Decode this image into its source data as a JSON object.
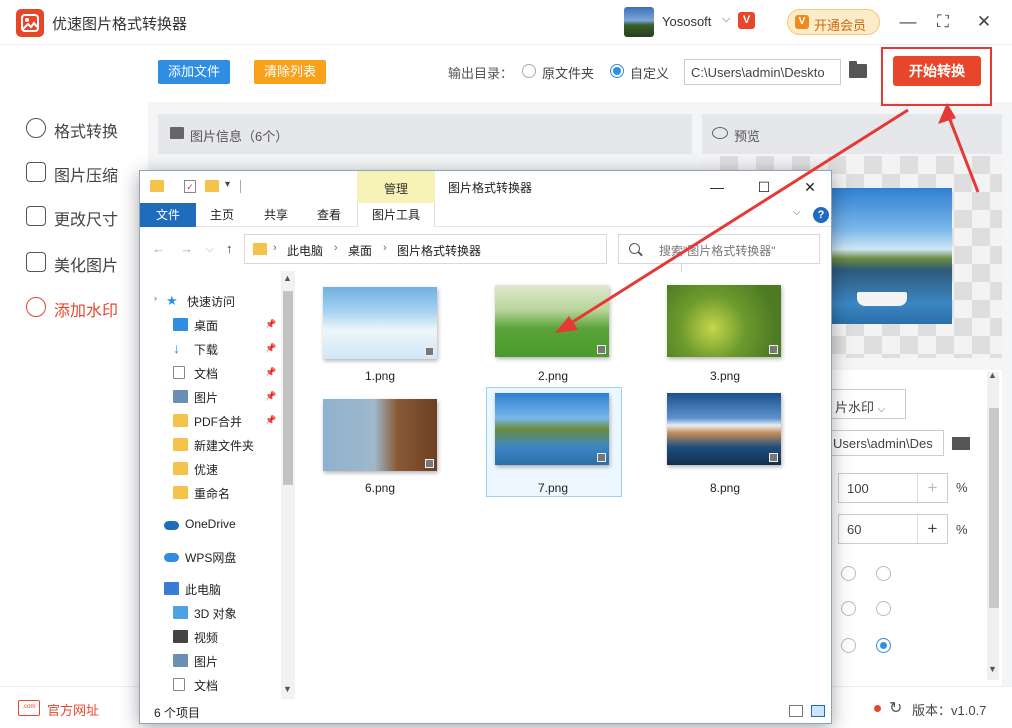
{
  "app": {
    "title": "优速图片格式转换器",
    "user_name": "Yososoft",
    "user_caret": "⌵",
    "user_badge": "V",
    "vip_label": "开通会员",
    "vip_icon": "V",
    "window_controls": [
      "—",
      "⛶",
      "✕"
    ]
  },
  "sidebar": {
    "items": [
      {
        "label": "格式转换",
        "icon": "convert-icon"
      },
      {
        "label": "图片压缩",
        "icon": "compress-icon"
      },
      {
        "label": "更改尺寸",
        "icon": "resize-icon"
      },
      {
        "label": "美化图片",
        "icon": "beautify-icon"
      },
      {
        "label": "添加水印",
        "icon": "watermark-icon",
        "active": true
      }
    ]
  },
  "toolbar": {
    "add_files": "添加文件",
    "clear_list": "清除列表",
    "output_label": "输出目录：",
    "radio_original": "原文件夹",
    "radio_custom": "自定义",
    "output_path": "C:\\Users\\admin\\Deskto",
    "start_button": "开始转换"
  },
  "panels": {
    "info_title": "图片信息（6个）",
    "preview_title": "预览"
  },
  "watermark_settings": {
    "type_select": "片水印",
    "watermark_path": "Users\\admin\\Des",
    "value1": "100",
    "value2": "60",
    "plus": "+",
    "percent": "%",
    "radio_selected_index": 5
  },
  "footer": {
    "site_label": "官方网址",
    "site_icon_text": ".com",
    "version": "版本：v1.0.7"
  },
  "explorer": {
    "manage_tab": "管理",
    "title": "图片格式转换器",
    "ribbon_tabs": [
      "文件",
      "主页",
      "共享",
      "查看",
      "图片工具"
    ],
    "breadcrumb": [
      "此电脑",
      "桌面",
      "图片格式转换器"
    ],
    "search_placeholder": "搜索\"图片格式转换器\"",
    "help": "?",
    "nav": [
      {
        "label": "快速访问",
        "icon": "star-icon",
        "color": "#2f8de4",
        "pinned": false
      },
      {
        "label": "桌面",
        "icon": "desktop-icon",
        "color": "#2f8de4",
        "pinned": true
      },
      {
        "label": "下载",
        "icon": "download-icon",
        "color": "#2f8de4",
        "pinned": true
      },
      {
        "label": "文档",
        "icon": "document-icon",
        "color": "#9a9a9a",
        "pinned": true
      },
      {
        "label": "图片",
        "icon": "pictures-icon",
        "color": "#6a8fb5",
        "pinned": true
      },
      {
        "label": "PDF合并",
        "icon": "folder-icon",
        "color": "#f3c449",
        "pinned": true
      },
      {
        "label": "新建文件夹",
        "icon": "folder-icon",
        "color": "#f3c449",
        "pinned": false
      },
      {
        "label": "优速",
        "icon": "folder-icon",
        "color": "#f3c449",
        "pinned": false
      },
      {
        "label": "重命名",
        "icon": "folder-icon",
        "color": "#f3c449",
        "pinned": false
      },
      {
        "label": "OneDrive",
        "icon": "cloud-icon",
        "color": "#1f6cbd",
        "pinned": false
      },
      {
        "label": "WPS网盘",
        "icon": "cloud-icon",
        "color": "#2f8de4",
        "pinned": false
      },
      {
        "label": "此电脑",
        "icon": "pc-icon",
        "color": "#3a7bd5",
        "pinned": false
      },
      {
        "label": "3D 对象",
        "icon": "cube-icon",
        "color": "#4ba3e2",
        "pinned": false
      },
      {
        "label": "视频",
        "icon": "video-icon",
        "color": "#444444",
        "pinned": false
      },
      {
        "label": "图片",
        "icon": "pictures-icon",
        "color": "#6a8fb5",
        "pinned": false
      },
      {
        "label": "文档",
        "icon": "document-icon",
        "color": "#9a9a9a",
        "pinned": false
      }
    ],
    "files": [
      {
        "name": "1.png"
      },
      {
        "name": "2.png"
      },
      {
        "name": "3.png"
      },
      {
        "name": "6.png"
      },
      {
        "name": "7.png",
        "selected": true
      },
      {
        "name": "8.png"
      }
    ],
    "status": "6 个项目"
  }
}
